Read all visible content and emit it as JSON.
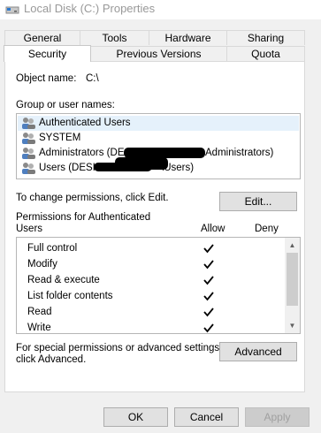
{
  "window": {
    "title": "Local Disk (C:) Properties",
    "icon": "drive-icon"
  },
  "tabs_row1": [
    "General",
    "Tools",
    "Hardware",
    "Sharing"
  ],
  "tabs_row2": [
    "Security",
    "Previous Versions",
    "Quota"
  ],
  "active_tab": "Security",
  "security": {
    "object_name_label": "Object name:",
    "object_name_value": "C:\\",
    "group_label": "Group or user names:",
    "groups": [
      {
        "name": "Authenticated Users",
        "selected": true
      },
      {
        "name": "SYSTEM",
        "selected": false
      },
      {
        "name": "Administrators (DESK",
        "name_tail": "Administrators)",
        "redacted": true
      },
      {
        "name": "Users (DESK",
        "name_tail": "\\Users)",
        "redacted": true
      }
    ],
    "change_text": "To change permissions, click Edit.",
    "edit_label": "Edit...",
    "perm_label_line1": "Permissions for Authenticated",
    "perm_label_line2": "Users",
    "allow_header": "Allow",
    "deny_header": "Deny",
    "permissions": [
      {
        "name": "Full control",
        "allow": true,
        "deny": false
      },
      {
        "name": "Modify",
        "allow": true,
        "deny": false
      },
      {
        "name": "Read & execute",
        "allow": true,
        "deny": false
      },
      {
        "name": "List folder contents",
        "allow": true,
        "deny": false
      },
      {
        "name": "Read",
        "allow": true,
        "deny": false
      },
      {
        "name": "Write",
        "allow": true,
        "deny": false
      }
    ],
    "special_text_line1": "For special permissions or advanced settings,",
    "special_text_line2": "click Advanced.",
    "advanced_label": "Advanced"
  },
  "footer": {
    "ok_label": "OK",
    "cancel_label": "Cancel",
    "apply_label": "Apply"
  },
  "colors": {
    "selected_row": "#e5f1fb",
    "button_bg": "#e1e1e1",
    "dialog_bg": "#f0f0f0",
    "title_text": "#999999"
  }
}
